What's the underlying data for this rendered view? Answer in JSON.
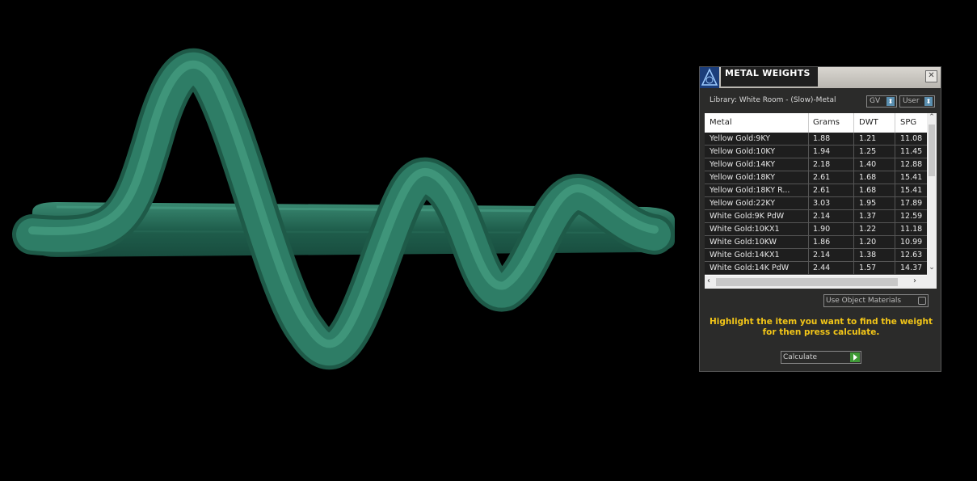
{
  "panel": {
    "title": "METAL WEIGHTS",
    "close_glyph": "✕",
    "library_label": "Library: White Room - (Slow)-Metal",
    "gv_select": "GV",
    "user_select": "User",
    "columns": [
      "Metal",
      "Grams",
      "DWT",
      "SPG"
    ],
    "rows": [
      [
        "Yellow Gold:9KY",
        "1.88",
        "1.21",
        "11.08"
      ],
      [
        "Yellow Gold:10KY",
        "1.94",
        "1.25",
        "11.45"
      ],
      [
        "Yellow Gold:14KY",
        "2.18",
        "1.40",
        "12.88"
      ],
      [
        "Yellow Gold:18KY",
        "2.61",
        "1.68",
        "15.41"
      ],
      [
        "Yellow Gold:18KY R...",
        "2.61",
        "1.68",
        "15.41"
      ],
      [
        "Yellow Gold:22KY",
        "3.03",
        "1.95",
        "17.89"
      ],
      [
        "White Gold:9K PdW",
        "2.14",
        "1.37",
        "12.59"
      ],
      [
        "White Gold:10KX1",
        "1.90",
        "1.22",
        "11.18"
      ],
      [
        "White Gold:10KW",
        "1.86",
        "1.20",
        "10.99"
      ],
      [
        "White Gold:14KX1",
        "2.14",
        "1.38",
        "12.63"
      ],
      [
        "White Gold:14K PdW",
        "2.44",
        "1.57",
        "14.37"
      ]
    ],
    "use_object_materials": "Use Object Materials",
    "instructions_line1": "Highlight the item you want to find the weight",
    "instructions_line2": "for then press calculate.",
    "calculate_label": "Calculate"
  },
  "colors": {
    "model": "#2e7d66",
    "accent_text": "#f2c518",
    "go_button": "#3f9a36"
  }
}
